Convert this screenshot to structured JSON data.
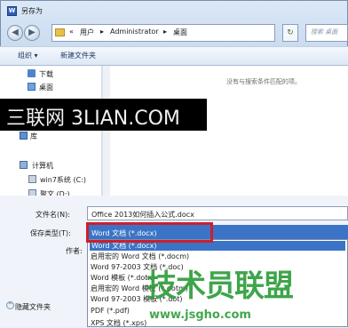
{
  "window": {
    "title": "另存为",
    "app_icon_label": "W"
  },
  "address": {
    "breadcrumb": [
      "«",
      "用户",
      "▸",
      "Administrator",
      "▸",
      "桌面"
    ],
    "refresh_glyph": "↻",
    "search_placeholder": "搜索 桌面"
  },
  "nav": {
    "back_glyph": "◀",
    "forward_glyph": "▶"
  },
  "toolbar": {
    "organize_label": "组织 ▾",
    "new_folder_label": "新建文件夹"
  },
  "content": {
    "empty_message": "没有与搜索条件匹配的项。"
  },
  "sidebar": {
    "items": [
      {
        "label": "下载",
        "icon": "download-folder-icon"
      },
      {
        "label": "桌面",
        "icon": "desktop-folder-icon"
      },
      {
        "label": "库",
        "icon": "library-icon"
      },
      {
        "label": "计算机",
        "icon": "computer-icon"
      },
      {
        "label": "win7系统 (C:)",
        "icon": "drive-icon"
      },
      {
        "label": "聚文 (D:)",
        "icon": "drive-icon"
      }
    ]
  },
  "watermark_top": "三联网 3LIAN.COM",
  "form": {
    "filename_label": "文件名(N):",
    "filename_value": "Office 2013如何插入公式.docx",
    "type_label": "保存类型(T):",
    "type_value": "Word 文档 (*.docx)",
    "author_label": "作者:"
  },
  "type_options": [
    "Word 文档 (*.docx)",
    "启用宏的 Word 文档 (*.docm)",
    "Word 97-2003 文档 (*.doc)",
    "Word 模板 (*.dotx)",
    "启用宏的 Word 模板 (*.dotm)",
    "Word 97-2003 模板 (*.dot)",
    "PDF (*.pdf)",
    "XPS 文档 (*.xps)"
  ],
  "hide_folders_label": "隐藏文件夹",
  "watermark_bottom": {
    "text": "技术员联盟",
    "url": "www.jsgho.com"
  },
  "colors": {
    "selection": "#3b74c7",
    "highlight_box": "#cf1e2a",
    "watermark_green": "#2e9e3b"
  }
}
